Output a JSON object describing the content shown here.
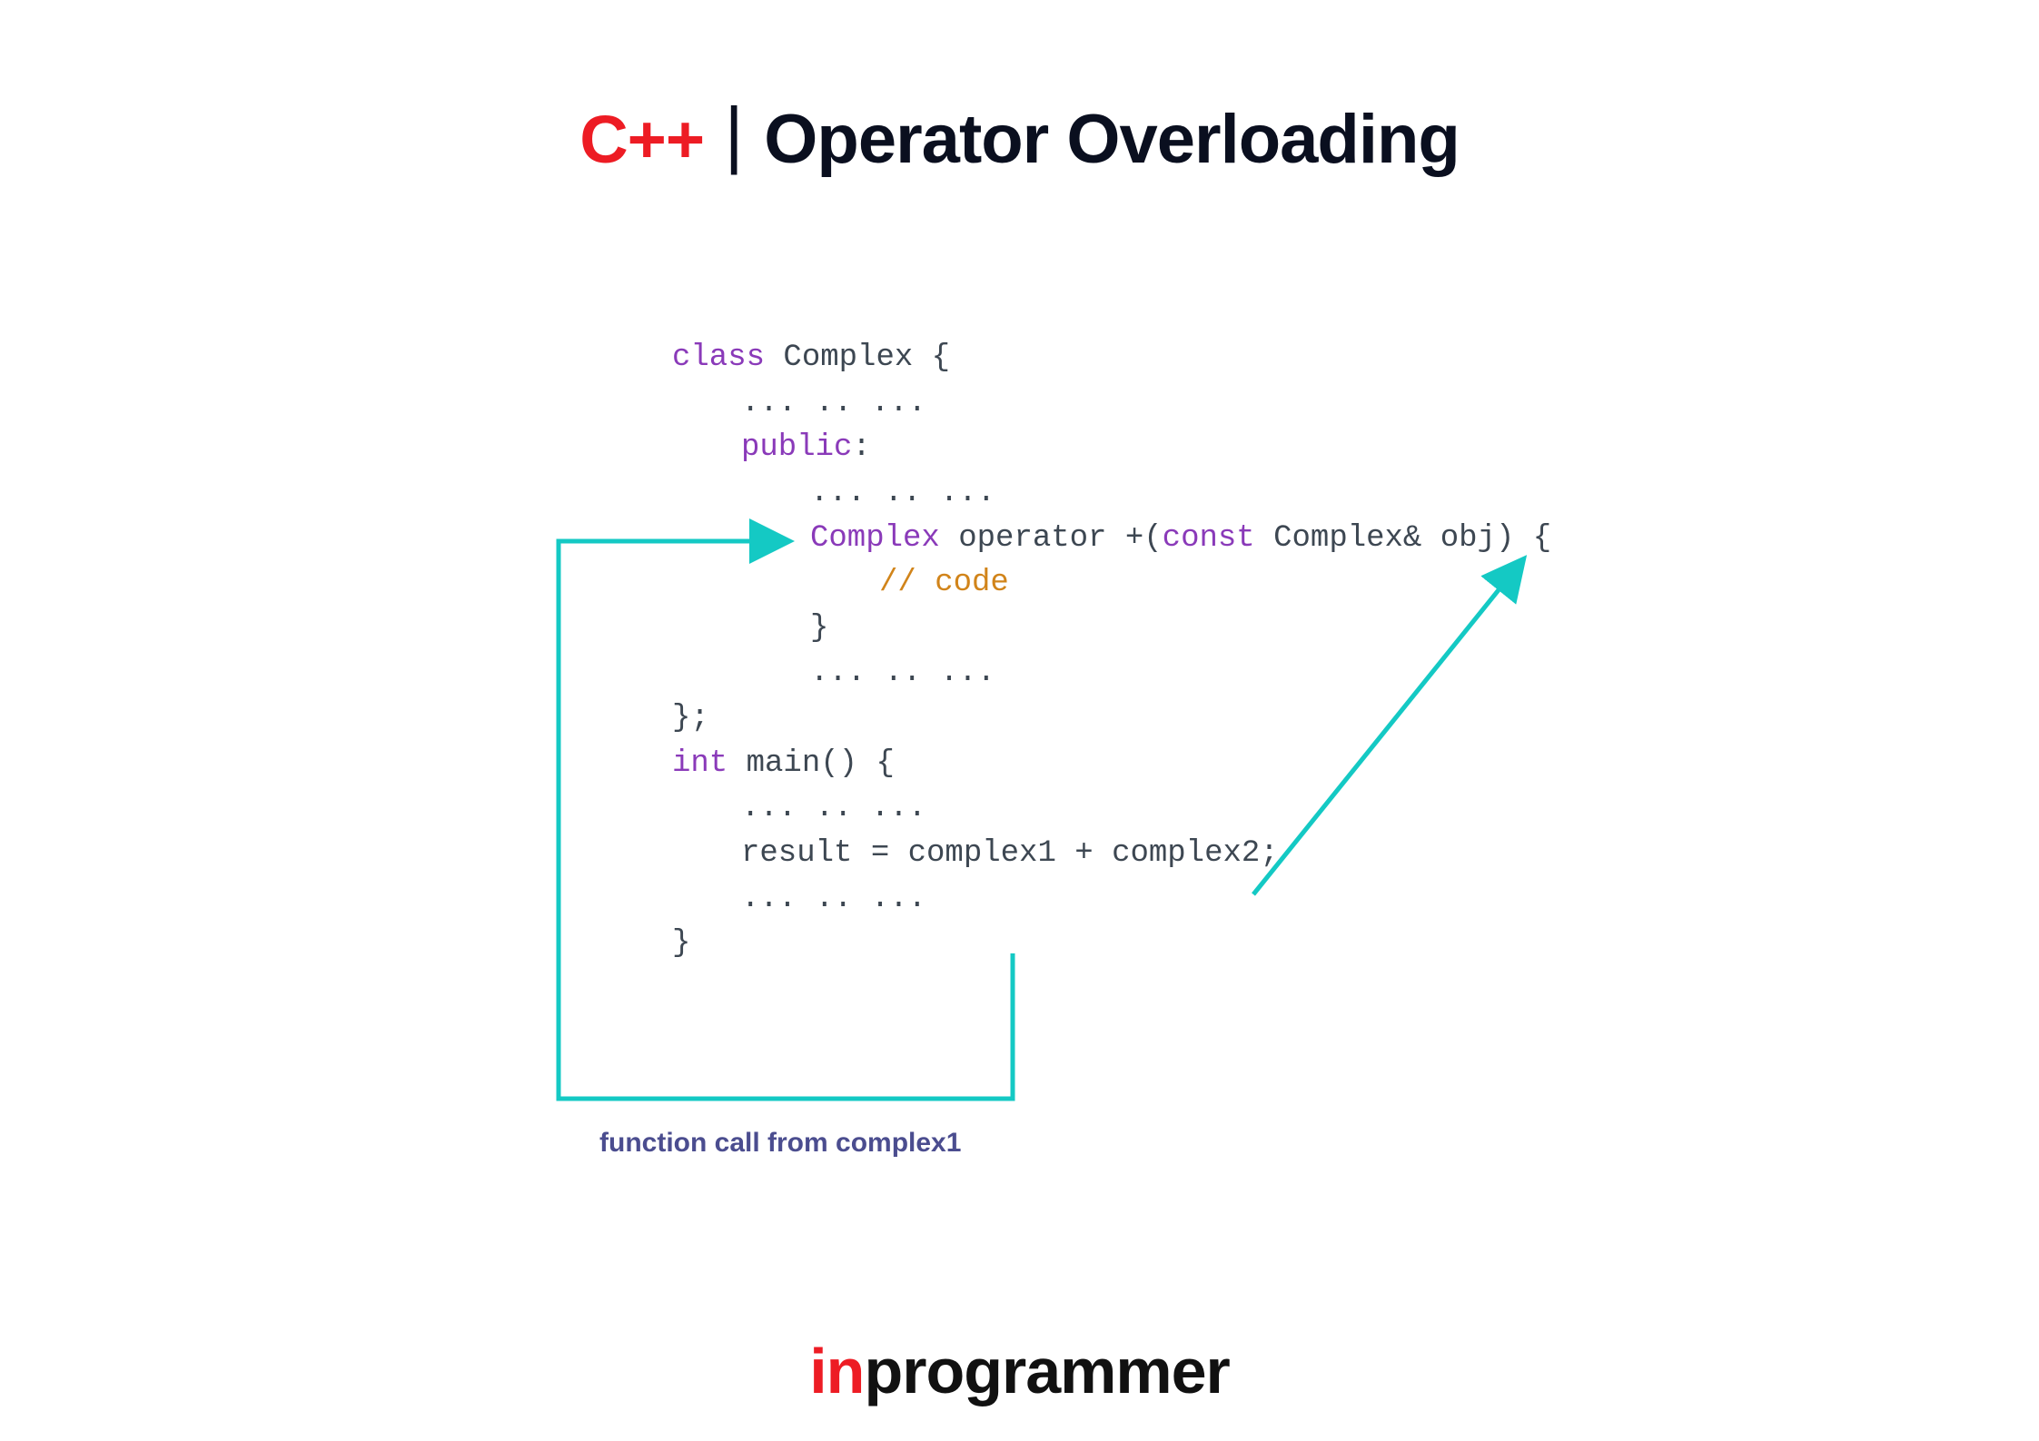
{
  "title": {
    "lang": "C++",
    "separator": "|",
    "topic": "Operator Overloading"
  },
  "code": {
    "l1_kw": "class",
    "l1_name": " Complex {",
    "l2": "... .. ...",
    "l3_kw": "public",
    "l3_colon": ":",
    "l4": "... .. ...",
    "l5_type": "Complex",
    "l5_op": " operator +(",
    "l5_const": "const",
    "l5_ref": " Complex& ",
    "l5_obj": "obj) {",
    "l6_cm": "// code",
    "l7": "}",
    "l8": "... .. ...",
    "l9": "};",
    "l10": "",
    "l11_int": "int",
    "l11_main": " main() {",
    "l12": "... .. ...",
    "l13": "result = complex1 + complex2;",
    "l14": "... .. ...",
    "l15": "}"
  },
  "caption": "function call from complex1",
  "brand": {
    "prefix": "in",
    "suffix": "programmer"
  },
  "colors": {
    "accent_red": "#ED1C24",
    "arrow_teal": "#14c9c4",
    "caption_purple": "#4b4d8f"
  }
}
